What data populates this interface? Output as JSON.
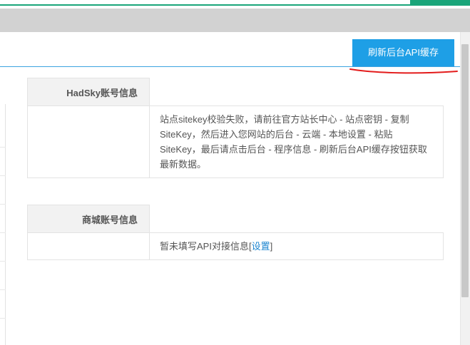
{
  "toolbar": {
    "refresh_button_label": "刷新后台API缓存"
  },
  "hadsky_section": {
    "title": "HadSky账号信息",
    "message": "站点sitekey校验失败，请前往官方站长中心 - 站点密钥 - 复制SiteKey，然后进入您网站的后台 - 云端 - 本地设置 - 粘贴SiteKey，最后请点击后台 - 程序信息 - 刷新后台API缓存按钮获取最新数据。"
  },
  "mall_section": {
    "title": "商城账号信息",
    "message_prefix": "暂未填写API对接信息[",
    "settings_link": "设置",
    "message_suffix": "]"
  },
  "colors": {
    "accent_green": "#1aa57a",
    "button_blue": "#1e9fe6",
    "annotation_red": "#e31b1b"
  }
}
